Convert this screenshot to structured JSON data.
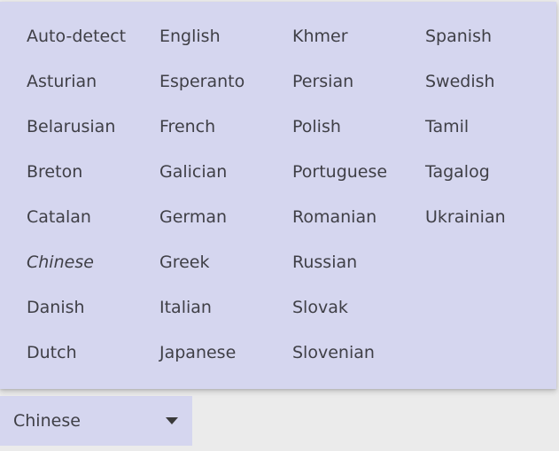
{
  "language_menu": {
    "columns": [
      [
        "Auto-detect",
        "Asturian",
        "Belarusian",
        "Breton",
        "Catalan",
        "Chinese",
        "Danish",
        "Dutch"
      ],
      [
        "English",
        "Esperanto",
        "French",
        "Galician",
        "German",
        "Greek",
        "Italian",
        "Japanese"
      ],
      [
        "Khmer",
        "Persian",
        "Polish",
        "Portuguese",
        "Romanian",
        "Russian",
        "Slovak",
        "Slovenian"
      ],
      [
        "Spanish",
        "Swedish",
        "Tamil",
        "Tagalog",
        "Ukrainian"
      ]
    ],
    "selected": "Chinese"
  },
  "select": {
    "value": "Chinese",
    "icon": "chevron-down-icon"
  },
  "colors": {
    "menu_background": "#d5d6ef",
    "page_background": "#ebebeb",
    "text": "#3f3f46"
  }
}
